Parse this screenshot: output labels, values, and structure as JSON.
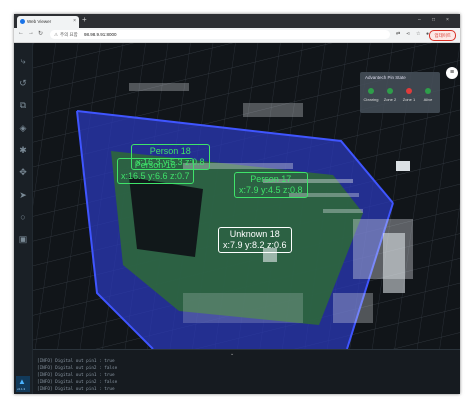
{
  "browser": {
    "tab_title": "Web Viewer",
    "tab_close": "×",
    "new_tab": "+",
    "insecure_label": "주의 요함",
    "url": "98.98.9.91:8000",
    "update_button": "업데이트",
    "nav": {
      "back": "←",
      "forward": "→",
      "reload": "↻"
    },
    "window_controls": {
      "minimize": "–",
      "maximize": "□",
      "close": "×"
    }
  },
  "toolbar": {
    "icons": [
      "route-icon",
      "loop-icon",
      "crop-icon",
      "target-icon",
      "walk-icon",
      "move-icon",
      "send-icon",
      "circle-icon",
      "save-icon"
    ],
    "glyphs": [
      "⤷",
      "↺",
      "⧉",
      "◈",
      "✱",
      "✥",
      "➤",
      "○",
      "▣"
    ],
    "logo_text": "v2.1.3",
    "logo_glyph": "▲"
  },
  "pin_panel": {
    "title": "Advantech Pin State",
    "pins": [
      {
        "label": "Clearing",
        "color": "#2e9e4a"
      },
      {
        "label": "Zone 2",
        "color": "#2e9e4a"
      },
      {
        "label": "Zone 1",
        "color": "#e03b3b"
      },
      {
        "label": "Alive",
        "color": "#2e9e4a"
      }
    ]
  },
  "menu_button": "≡",
  "labels": [
    {
      "name": "Person 18",
      "coords": "x:16.3 y:5.3 z:0.8",
      "color": "#3fe36a"
    },
    {
      "name": "Person 16",
      "coords": "x:16.5 y:6.6 z:0.7",
      "color": "#3fe36a"
    },
    {
      "name": "Person 17",
      "coords": "x:7.9 y:4.5 z:0.8",
      "color": "#3fe36a"
    },
    {
      "name": "Unknown 18",
      "coords": "x:7.9 y:8.2 z:0.6",
      "color": "#ffffff"
    }
  ],
  "log": {
    "handle": "⌄",
    "lines": [
      "[INFO] Digital out pin1 : true",
      "[INFO] Digital out pin2 : false",
      "[INFO] Digital out pin1 : true",
      "[INFO] Digital out pin2 : false",
      "[INFO] Digital out pin1 : true"
    ]
  }
}
